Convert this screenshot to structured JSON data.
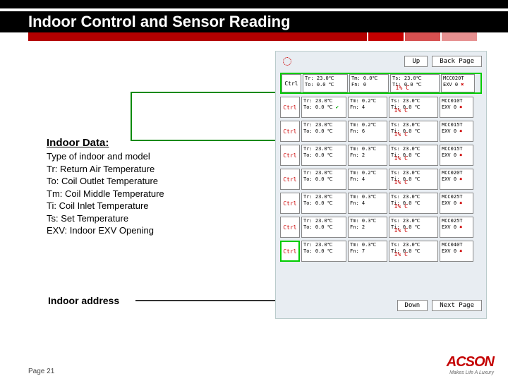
{
  "title": "Indoor Control and Sensor Reading",
  "panel": {
    "btn_up": "Up",
    "btn_back": "Back Page",
    "btn_down": "Down",
    "btn_next": "Next Page",
    "ctrl_label": "Ctrl"
  },
  "rows": [
    {
      "tr": "Tr: 23.0℃",
      "to": "To: 0.0 ℃",
      "tm": "Tm: 0.0℃",
      "fn": "Fn: 0",
      "ts": "Ts: 23.0℃",
      "ti": "Ti: 0.0 ℃",
      "model": "MCC020T",
      "exv": "EXV   0",
      "ipc": "I% C"
    },
    {
      "tr": "Tr: 23.0℃",
      "to": "To: 0.0 ℃",
      "tm": "Tm: 0.2℃",
      "fn": "Fn: 4",
      "ts": "Ts: 23.0℃",
      "ti": "Ti: 0.0 ℃",
      "model": "MCC010T",
      "exv": "EXV   0",
      "ipc": "I% C"
    },
    {
      "tr": "Tr: 23.0℃",
      "to": "To: 0.0 ℃",
      "tm": "Tm: 0.2℃",
      "fn": "Fn: 6",
      "ts": "Ts: 23.0℃",
      "ti": "Ti: 0.0 ℃",
      "model": "MCC015T",
      "exv": "EXV   0",
      "ipc": "I% C"
    },
    {
      "tr": "Tr: 23.0℃",
      "to": "To: 0.0 ℃",
      "tm": "Tm: 0.3℃",
      "fn": "Fn: 2",
      "ts": "Ts: 23.0℃",
      "ti": "Ti: 0.0 ℃",
      "model": "MCC015T",
      "exv": "EXV   0",
      "ipc": "I% C"
    },
    {
      "tr": "Tr: 23.0℃",
      "to": "To: 0.0 ℃",
      "tm": "Tm: 0.2℃",
      "fn": "Fn: 4",
      "ts": "Ts: 23.0℃",
      "ti": "Ti: 0.0 ℃",
      "model": "MCC020T",
      "exv": "EXV   0",
      "ipc": "I% C"
    },
    {
      "tr": "Tr: 23.0℃",
      "to": "To: 0.0 ℃",
      "tm": "Tm: 0.3℃",
      "fn": "Fn: 4",
      "ts": "Ts: 23.0℃",
      "ti": "Ti: 0.0 ℃",
      "model": "MCC025T",
      "exv": "EXV   0",
      "ipc": "I% C"
    },
    {
      "tr": "Tr: 23.0℃",
      "to": "To: 0.0 ℃",
      "tm": "Tm: 0.3℃",
      "fn": "Fn: 2",
      "ts": "Ts: 23.0℃",
      "ti": "Ti: 0.0 ℃",
      "model": "MCC025T",
      "exv": "EXV   0",
      "ipc": "I% C"
    },
    {
      "tr": "Tr: 23.0℃",
      "to": "To: 0.0 ℃",
      "tm": "Tm: 0.3℃",
      "fn": "Fn: 7",
      "ts": "Ts: 23.0℃",
      "ti": "Ti: 0.0 ℃",
      "model": "MCC040T",
      "exv": "EXV   0",
      "ipc": "I% C"
    }
  ],
  "indoor_data": {
    "heading": "Indoor Data:",
    "lines": [
      "Type of indoor and model",
      "Tr: Return Air Temperature",
      "To: Coil Outlet Temperature",
      "Tm: Coil Middle Temperature",
      "Ti: Coil Inlet Temperature",
      "Ts: Set Temperature",
      "EXV: Indoor EXV Opening"
    ]
  },
  "indoor_address": "Indoor address",
  "footer": "Page 21",
  "logo": {
    "main": "ACSON",
    "sub": "Makes Life A Luxury"
  }
}
